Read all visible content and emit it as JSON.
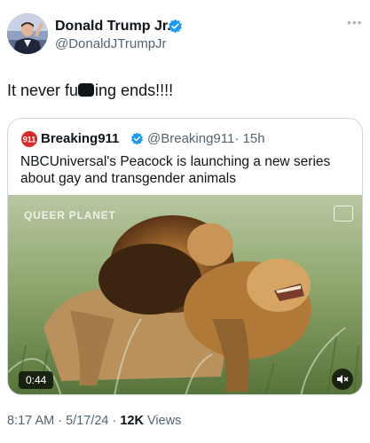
{
  "author": {
    "name": "Donald Trump Jr.",
    "handle": "@DonaldJTrumpJr",
    "verified": true
  },
  "tweet": {
    "text_before": "It never fu",
    "text_after": "ing ends!!!!"
  },
  "quoted": {
    "name": "Breaking911",
    "handle": "@Breaking911",
    "time": "· 15h",
    "text": "NBCUniversal's Peacock is launching a new series about gay and transgender animals",
    "logo_text": "911",
    "media": {
      "watermark": "QUEER PLANET",
      "duration": "0:44"
    }
  },
  "meta": {
    "time": "8:17 AM",
    "date": "5/17/24",
    "views_count": "12K",
    "views_label": "Views"
  },
  "colors": {
    "verified_blue": "#1d9bf0",
    "text": "#0f1419",
    "secondary": "#536471",
    "border": "#cfd9de",
    "breaking911_red": "#d62b2b"
  },
  "icons": [
    "more-icon",
    "verified-badge-icon",
    "breaking911-logo-icon",
    "media-settings-icon",
    "mute-icon"
  ]
}
